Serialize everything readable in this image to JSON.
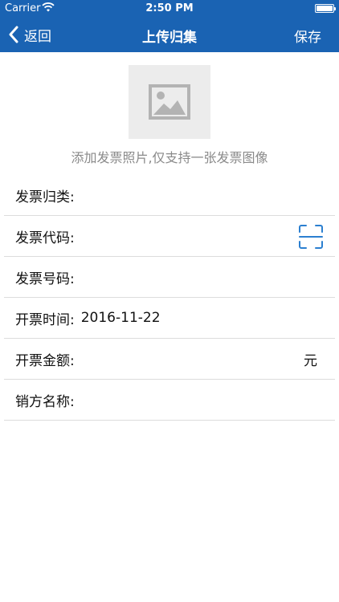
{
  "status_bar": {
    "carrier": "Carrier",
    "time": "2:50 PM"
  },
  "nav": {
    "back_label": "返回",
    "title": "上传归集",
    "save_label": "保存"
  },
  "photo": {
    "hint": "添加发票照片,仅支持一张发票图像"
  },
  "form": {
    "rows": [
      {
        "label": "发票归类:",
        "value": ""
      },
      {
        "label": "发票代码:",
        "value": ""
      },
      {
        "label": "发票号码:",
        "value": ""
      },
      {
        "label": "开票时间:",
        "value": "2016-11-22"
      },
      {
        "label": "开票金额:",
        "value": "",
        "unit": "元"
      },
      {
        "label": "销方名称:",
        "value": ""
      }
    ]
  },
  "colors": {
    "nav_background": "#1a63b3",
    "scan_icon": "#2b7fd0",
    "hint_text": "#8a8a8a"
  }
}
